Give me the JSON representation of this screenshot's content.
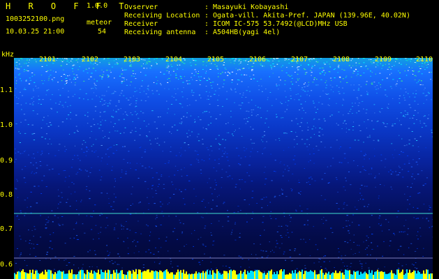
{
  "header": {
    "app_title": "H R O F F T",
    "version": "1.0.0",
    "filename": "1003252100.png",
    "datetime": "10.03.25 21:00",
    "count_label": "meteor",
    "count_value": "54"
  },
  "info": {
    "labels": [
      "Ovserver",
      "Receiving Location",
      "Receiver",
      "Receiving antenna"
    ],
    "values": [
      "Masayuki Kobayashi",
      "Ogata-vill. Akita-Pref. JAPAN (139.96E, 40.02N)",
      "ICOM IC-575 53.7492(@LCD)MHz USB",
      "A504HB(yagi 4el)"
    ],
    "separator": ":"
  },
  "axis": {
    "unit": "kHz",
    "y_ticks": [
      "1.1",
      "1.0",
      "0.9",
      "0.8",
      "0.7",
      "0.6"
    ],
    "x_ticks": [
      "2101",
      "2102",
      "2103",
      "2104",
      "2105",
      "2106",
      "2107",
      "2108",
      "2109",
      "2110"
    ]
  },
  "colors": {
    "text": "#ffff00",
    "background": "#000000",
    "carrier_line": "#40e0d0"
  }
}
